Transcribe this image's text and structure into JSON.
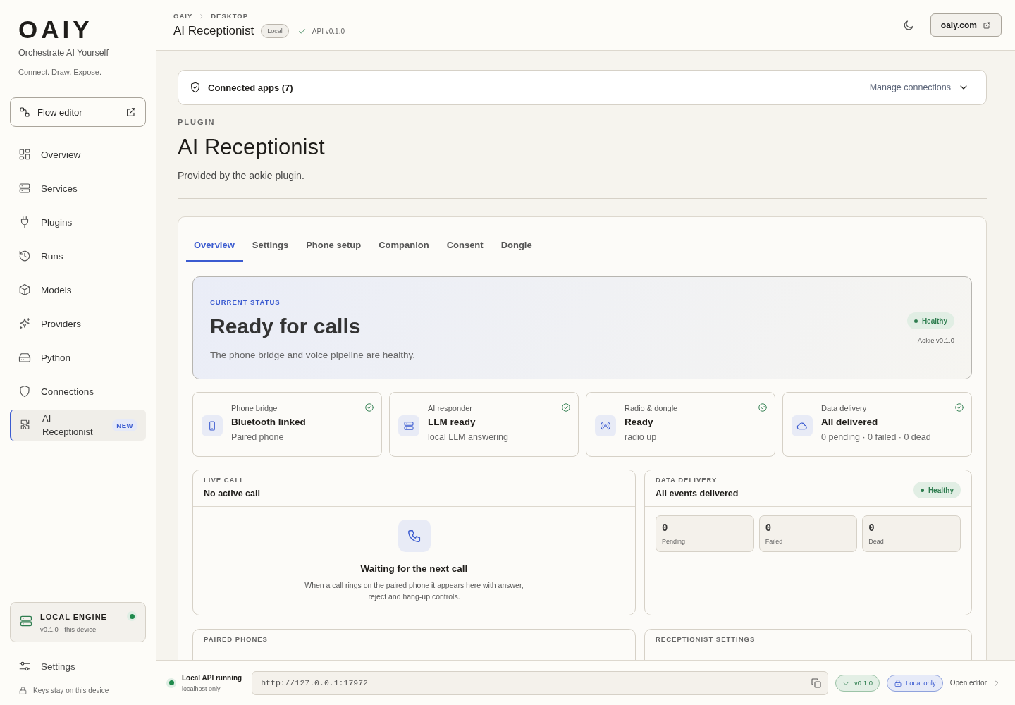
{
  "sidebar": {
    "logo": "OAIY",
    "tagline": "Orchestrate AI Yourself",
    "motto": "Connect. Draw. Expose.",
    "flow_button": "Flow editor",
    "items": [
      {
        "label": "Overview",
        "selected": false
      },
      {
        "label": "Services",
        "selected": false
      },
      {
        "label": "Plugins",
        "selected": false
      },
      {
        "label": "Runs",
        "selected": false
      },
      {
        "label": "Models",
        "selected": false
      },
      {
        "label": "Providers",
        "selected": false
      },
      {
        "label": "Python",
        "selected": false
      },
      {
        "label": "Connections",
        "selected": false
      },
      {
        "label": "AI Receptionist",
        "selected": true,
        "badge": "NEW"
      }
    ],
    "engine": {
      "title": "LOCAL ENGINE",
      "subtitle": "v0.1.0 · this device",
      "online": true
    },
    "settings": "Settings",
    "footnote": "Keys stay on this device"
  },
  "header": {
    "breadcrumb": [
      "OAIY",
      "DESKTOP"
    ],
    "title": "AI Receptionist",
    "badge": "Local",
    "api": "API v0.1.0",
    "site_button": "oaiy.com"
  },
  "connected": {
    "label": "Connected apps (7)",
    "action": "Manage connections"
  },
  "plugin": {
    "eyebrow": "PLUGIN",
    "title": "AI Receptionist",
    "description": "Provided by the aokie plugin."
  },
  "tabs": [
    {
      "label": "Overview",
      "selected": true
    },
    {
      "label": "Settings",
      "selected": false
    },
    {
      "label": "Phone setup",
      "selected": false
    },
    {
      "label": "Companion",
      "selected": false
    },
    {
      "label": "Consent",
      "selected": false
    },
    {
      "label": "Dongle",
      "selected": false
    }
  ],
  "status": {
    "eyebrow": "CURRENT STATUS",
    "title": "Ready for calls",
    "description": "The phone bridge and voice pipeline are healthy.",
    "badge": "Healthy",
    "version": "Aokie v0.1.0"
  },
  "components": [
    {
      "label": "Phone bridge",
      "title": "Bluetooth linked",
      "detail": "Paired phone",
      "ok": true
    },
    {
      "label": "AI responder",
      "title": "LLM ready",
      "detail": "local LLM answering",
      "ok": true
    },
    {
      "label": "Radio & dongle",
      "title": "Ready",
      "detail": "radio up",
      "ok": true
    },
    {
      "label": "Data delivery",
      "title": "All delivered",
      "detail": "0 pending · 0 failed · 0 dead",
      "ok": true
    }
  ],
  "live_call": {
    "eyebrow": "LIVE CALL",
    "title": "No active call",
    "empty_title": "Waiting for the next call",
    "empty_text": "When a call rings on the paired phone it appears here with answer, reject and hang-up controls."
  },
  "delivery": {
    "eyebrow": "DATA DELIVERY",
    "title": "All events delivered",
    "badge": "Healthy",
    "counters": [
      {
        "value": "0",
        "label": "Pending"
      },
      {
        "value": "0",
        "label": "Failed"
      },
      {
        "value": "0",
        "label": "Dead"
      }
    ]
  },
  "sections": [
    {
      "eyebrow": "PAIRED PHONES"
    },
    {
      "eyebrow": "RECEPTIONIST SETTINGS"
    }
  ],
  "footer": {
    "status": "Local API running",
    "substatus": "localhost only",
    "running": true,
    "url": "http://127.0.0.1:17972",
    "version": "v0.1.0",
    "scope": "Local only",
    "link": "Open editor"
  }
}
